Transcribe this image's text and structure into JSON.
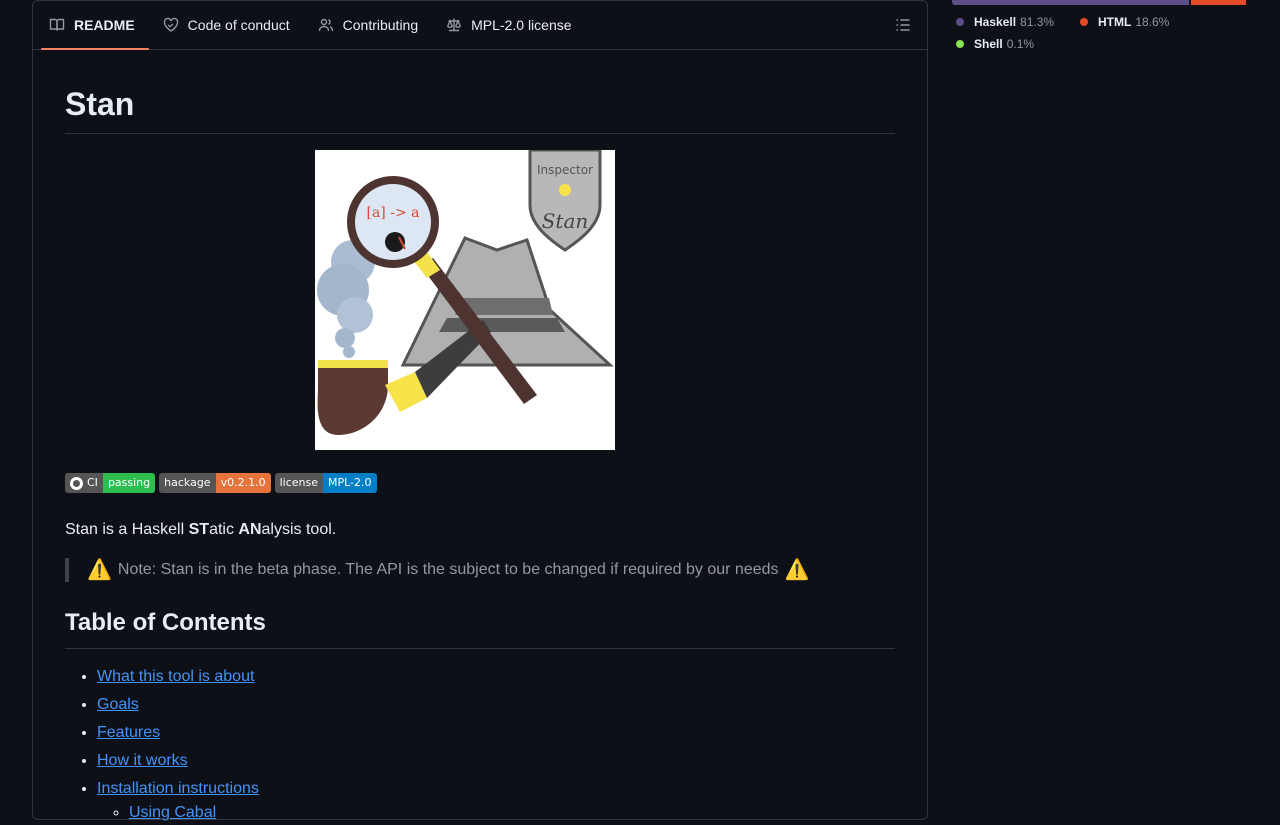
{
  "tabs": [
    {
      "label": "README",
      "icon": "book-icon",
      "active": true
    },
    {
      "label": "Code of conduct",
      "icon": "heart-icon",
      "active": false
    },
    {
      "label": "Contributing",
      "icon": "people-icon",
      "active": false
    },
    {
      "label": "MPL-2.0 license",
      "icon": "law-icon",
      "active": false
    }
  ],
  "readme": {
    "title": "Stan",
    "logo": {
      "text_label": "[a] -> a",
      "badge_text": "Inspector",
      "badge_name": "Stan"
    },
    "badges": [
      {
        "left": "CI",
        "right": "passing",
        "color": "#2ebd4e",
        "icon": "github-icon"
      },
      {
        "left": "hackage",
        "right": "v0.2.1.0",
        "color": "#e5733b"
      },
      {
        "left": "license",
        "right": "MPL-2.0",
        "color": "#007ec6"
      }
    ],
    "intro": {
      "before": "Stan is a Haskell ",
      "b1": "ST",
      "mid1": "atic ",
      "b2": "AN",
      "after": "alysis tool."
    },
    "note": "Note: Stan is in the beta phase. The API is the subject to be changed if required by our needs",
    "toc_title": "Table of Contents",
    "toc": [
      "What this tool is about",
      "Goals",
      "Features",
      "How it works",
      "Installation instructions"
    ],
    "toc_sub": [
      "Using Cabal"
    ]
  },
  "languages": [
    {
      "name": "Haskell",
      "pct": "81.3%",
      "color": "#5e5086"
    },
    {
      "name": "HTML",
      "pct": "18.6%",
      "color": "#e34c26"
    },
    {
      "name": "Shell",
      "pct": "0.1%",
      "color": "#89e051"
    }
  ],
  "language_shares": [
    81.3,
    18.6,
    0.1
  ]
}
